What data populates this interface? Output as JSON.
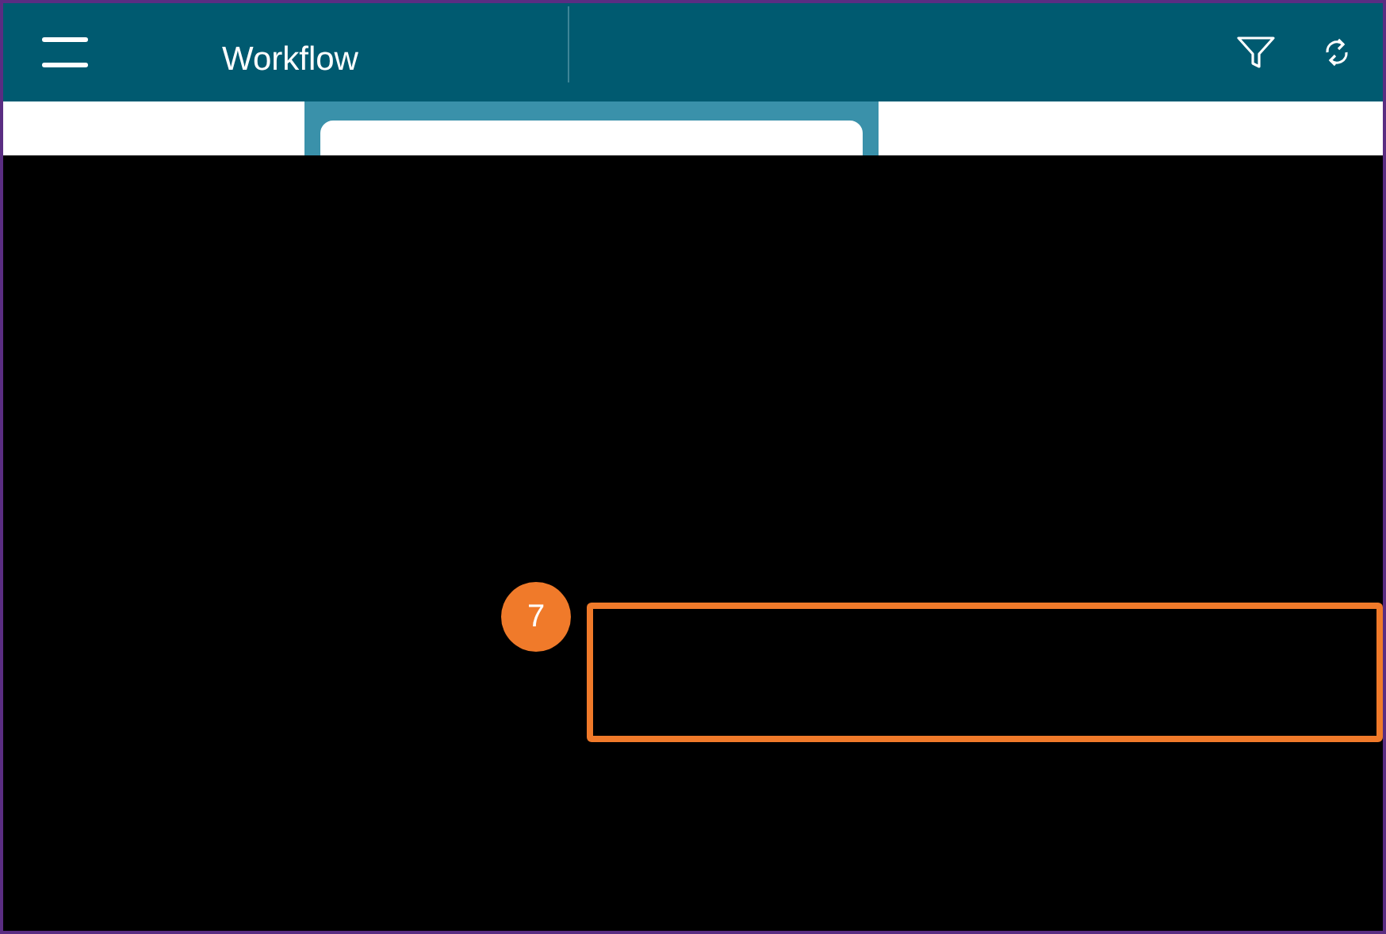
{
  "header": {
    "title": "Workflow"
  },
  "callouts": [
    {
      "number": "7"
    }
  ]
}
